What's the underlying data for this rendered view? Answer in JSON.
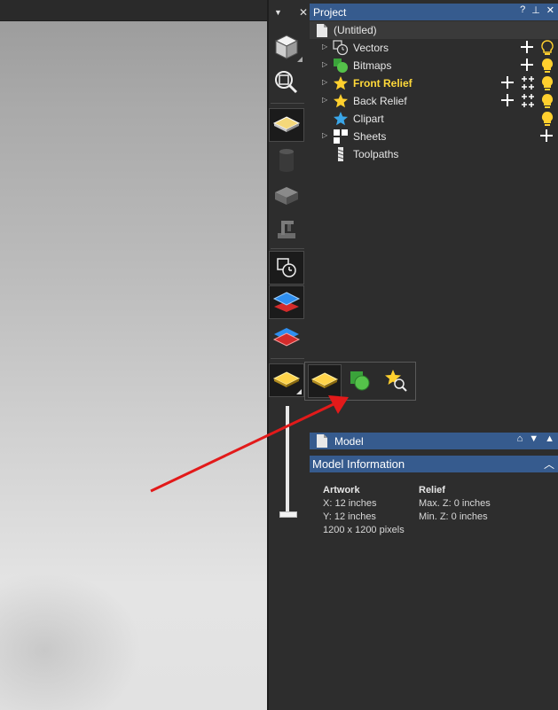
{
  "toolbar": {
    "dropdown_glyph": "▼",
    "close_glyph": "✕",
    "buttons": [
      {
        "name": "3d-view-icon"
      },
      {
        "name": "zoom-to-fit-icon"
      },
      {
        "name": "relief-layer-icon"
      },
      {
        "name": "cylinder-icon"
      },
      {
        "name": "block-icon"
      },
      {
        "name": "machine-icon"
      },
      {
        "name": "vector-clock-icon"
      },
      {
        "name": "blue-layer-stack-icon"
      },
      {
        "name": "red-layer-stack-icon"
      },
      {
        "name": "yellow-layer-icon"
      }
    ]
  },
  "project": {
    "title": "Project",
    "controls": {
      "help": "?",
      "pin": "⊥",
      "close": "✕"
    },
    "root": "(Untitled)",
    "items": [
      {
        "label": "Vectors",
        "icon": "vectors-icon",
        "expandable": true,
        "actions": [
          "plus",
          "bulb-outline"
        ]
      },
      {
        "label": "Bitmaps",
        "icon": "bitmaps-icon",
        "expandable": true,
        "actions": [
          "plus",
          "bulb"
        ]
      },
      {
        "label": "Front Relief",
        "icon": "star-icon",
        "expandable": true,
        "bold": true,
        "actions": [
          "plus",
          "grid-plus",
          "bulb"
        ]
      },
      {
        "label": "Back Relief",
        "icon": "star-icon",
        "expandable": true,
        "actions": [
          "plus",
          "grid-plus",
          "bulb"
        ]
      },
      {
        "label": "Clipart",
        "icon": "blue-star-icon",
        "expandable": false,
        "actions": [
          "bulb"
        ]
      },
      {
        "label": "Sheets",
        "icon": "sheets-icon",
        "expandable": true,
        "actions": [
          "plus"
        ]
      },
      {
        "label": "Toolpaths",
        "icon": "toolpath-icon",
        "expandable": false,
        "actions": []
      }
    ]
  },
  "model": {
    "title": "Model",
    "section_title": "Model Information",
    "artwork": {
      "heading": "Artwork",
      "x": "X: 12 inches",
      "y": "Y: 12 inches",
      "pixels": "1200 x 1200 pixels"
    },
    "relief": {
      "heading": "Relief",
      "max_z": "Max. Z: 0 inches",
      "min_z": "Min. Z: 0 inches"
    }
  },
  "colors": {
    "panel_header": "#365b8e",
    "relief_gold": "#ffd93a",
    "annotation_arrow": "#e21a1a"
  }
}
